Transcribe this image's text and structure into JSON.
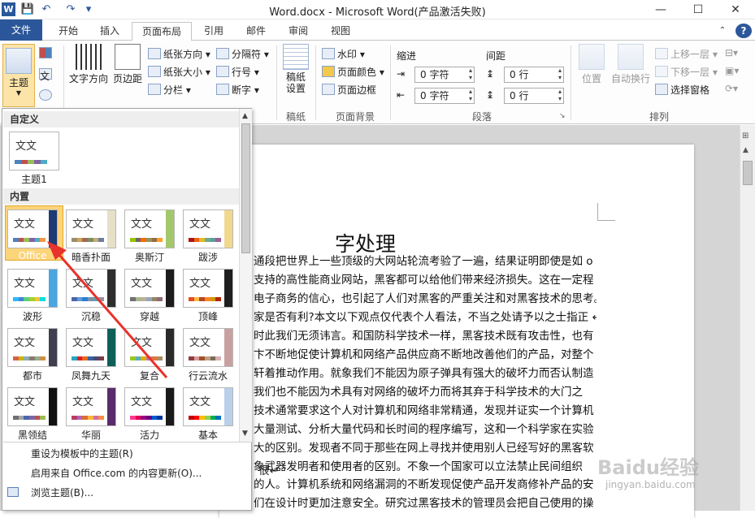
{
  "window": {
    "title": "Word.docx - Microsoft Word(产品激活失败)",
    "app_icon": "W",
    "minimize": "—",
    "maximize": "☐",
    "close": "✕"
  },
  "qat": {
    "save": "💾",
    "undo": "↶",
    "redo": "↷",
    "more": "▾"
  },
  "tabs": [
    {
      "label": "文件"
    },
    {
      "label": "开始"
    },
    {
      "label": "插入"
    },
    {
      "label": "页面布局"
    },
    {
      "label": "引用"
    },
    {
      "label": "邮件"
    },
    {
      "label": "审阅"
    },
    {
      "label": "视图"
    }
  ],
  "ribbon": {
    "theme": {
      "label": "主题"
    },
    "page_setup": {
      "text_direction": "文字方向",
      "margins": "页边距",
      "orientation": "纸张方向",
      "size": "纸张大小",
      "columns": "分栏",
      "breaks": "分隔符",
      "line_numbers": "行号",
      "hyphenation": "断字"
    },
    "draft": {
      "label": "稿纸\n设置",
      "group": "稿纸"
    },
    "background": {
      "watermark": "水印",
      "page_color": "页面颜色",
      "page_border": "页面边框",
      "group": "页面背景"
    },
    "paragraph": {
      "indent": "缩进",
      "spacing": "间距",
      "indent_left": "0 字符",
      "indent_right": "0 字符",
      "spacing_before": "0 行",
      "spacing_after": "0 行",
      "group": "段落"
    },
    "arrange": {
      "position": "位置",
      "wrap": "自动换行",
      "bring_forward": "上移一层",
      "send_backward": "下移一层",
      "selection_pane": "选择窗格",
      "group": "排列"
    }
  },
  "panel": {
    "custom_header": "自定义",
    "builtin_header": "内置",
    "custom_theme": {
      "label": "主题1",
      "glyph": "文文"
    },
    "themes": [
      {
        "label": "Office",
        "glyph": "文文",
        "side": "#1f3b74",
        "bars": [
          "#4f81bd",
          "#c0504d",
          "#9bbb59",
          "#8064a2",
          "#4bacc6",
          "#f79646"
        ]
      },
      {
        "label": "暗香扑面",
        "glyph": "文文",
        "side": "#e6e0c8",
        "bars": [
          "#9e8b6f",
          "#d1a54c",
          "#a16a5b",
          "#7f8f5b",
          "#c2ad7a",
          "#6d7f9e"
        ]
      },
      {
        "label": "奥斯汀",
        "glyph": "文文",
        "side": "#a3c86b",
        "bars": [
          "#94c600",
          "#71685a",
          "#ff6700",
          "#909465",
          "#956b43",
          "#fea022"
        ]
      },
      {
        "label": "跋涉",
        "glyph": "文文",
        "side": "#f0d98f",
        "bars": [
          "#b01513",
          "#ea6312",
          "#e6b729",
          "#6aac90",
          "#5f9c9d",
          "#9e5e9b"
        ]
      },
      {
        "label": "波形",
        "glyph": "文文",
        "side": "#4aa6e0",
        "bars": [
          "#31b6fd",
          "#4584d3",
          "#5bd078",
          "#a5d028",
          "#f5c040",
          "#05e0db"
        ]
      },
      {
        "label": "沉稳",
        "glyph": "文文",
        "side": "#2e2e2e",
        "bars": [
          "#4a66ac",
          "#629dd1",
          "#297fd5",
          "#7f8fa9",
          "#5aa2ae",
          "#9d90a0"
        ]
      },
      {
        "label": "穿越",
        "glyph": "文文",
        "side": "#1c1c1c",
        "bars": [
          "#6f6f74",
          "#a7b789",
          "#beae98",
          "#92a9b9",
          "#9c8265",
          "#8d6974"
        ]
      },
      {
        "label": "顶峰",
        "glyph": "文文",
        "side": "#1f1f1f",
        "bars": [
          "#e84c22",
          "#ffbd47",
          "#b64926",
          "#ff8427",
          "#cc9900",
          "#b22600"
        ]
      },
      {
        "label": "都市",
        "glyph": "文文",
        "side": "#3f3f4f",
        "bars": [
          "#d16349",
          "#ccb400",
          "#8cadae",
          "#8c7b70",
          "#8fb08c",
          "#d19049"
        ]
      },
      {
        "label": "凤舞九天",
        "glyph": "文文",
        "side": "#0f5f59",
        "bars": [
          "#2da2bf",
          "#da1f28",
          "#eb641b",
          "#39639d",
          "#474b78",
          "#7d3c4a"
        ]
      },
      {
        "label": "复合",
        "glyph": "文文",
        "side": "#2a2a2a",
        "bars": [
          "#98c723",
          "#59b0b9",
          "#deae00",
          "#b77bb4",
          "#e0773c",
          "#a98d63"
        ]
      },
      {
        "label": "行云流水",
        "glyph": "文文",
        "side": "#c8a0a0",
        "bars": [
          "#8b3d3d",
          "#d99a9a",
          "#a0522d",
          "#c0a080",
          "#7b6b5b",
          "#d8b0b0"
        ]
      },
      {
        "label": "黑领结",
        "glyph": "文文",
        "side": "#111111",
        "bars": [
          "#6f6f74",
          "#a5a5a5",
          "#4a66ac",
          "#8064a2",
          "#c0504d",
          "#9bbb59"
        ]
      },
      {
        "label": "华丽",
        "glyph": "文文",
        "side": "#5a2c6b",
        "bars": [
          "#b83d68",
          "#ac66bb",
          "#de6c36",
          "#f9b639",
          "#cf6da4",
          "#fa8d3d"
        ]
      },
      {
        "label": "活力",
        "glyph": "文文",
        "side": "#1a1a1a",
        "bars": [
          "#ff388c",
          "#e40059",
          "#9c007f",
          "#68007f",
          "#005bd3",
          "#00349e"
        ]
      },
      {
        "label": "基本",
        "glyph": "文文",
        "side": "#b8d0e8",
        "bars": [
          "#c00000",
          "#ff0000",
          "#ffc000",
          "#92d050",
          "#00b050",
          "#0070c0"
        ]
      }
    ],
    "menu": [
      {
        "label": "重设为模板中的主题(R)"
      },
      {
        "label": "启用来自 Office.com 的内容更新(O)..."
      },
      {
        "label": "浏览主题(B)..."
      }
    ]
  },
  "document": {
    "title": "字处理",
    "lines": [
      "通段把世界上一些顶级的大网站轮流考验了一遍，结果证明即使是如 o",
      "支持的高性能商业网站，黑客都可以给他们带来经济损失。这在一定程",
      "电子商务的信心，也引起了人们对黑客的严重关注和对黑客技术的思考。",
      "家是否有利?本文以下观点仅代表个人看法，不当之处请予以之士指正 ↵",
      "时此我们无须讳言。和国防科学技术一样，黑客技术既有攻击性，也有",
      "卞不断地促使计算机和网络产品供应商不断地改善他们的产品，对整个",
      "轩着推动作用。就象我们不能因为原子弹具有强大的破坏力而否认制造",
      "我们也不能因为术具有对网络的破坏力而将其弃于科学技术的大门之",
      "技术通常要求这个人对计算机和网络非常精通，发现并证实一个计算机",
      "大量测试、分析大量代码和长时间的程序编写，这和一个科学家在实验",
      "大的区别。发现者不同于那些在网上寻找并使用别人已经写好的黑客软",
      "象武器发明者和使用者的区别。不象一个国家可以立法禁止民间组织",
      "很↵",
      "的人。计算机系统和网络漏洞的不断发现促使产品开发商修补产品的安",
      "们在设计时更加注意安全。研究过黑客技术的管理员会把自己使用的操"
    ]
  },
  "watermark": {
    "text": "Baidu经验",
    "url": "jingyan.baidu.com"
  }
}
